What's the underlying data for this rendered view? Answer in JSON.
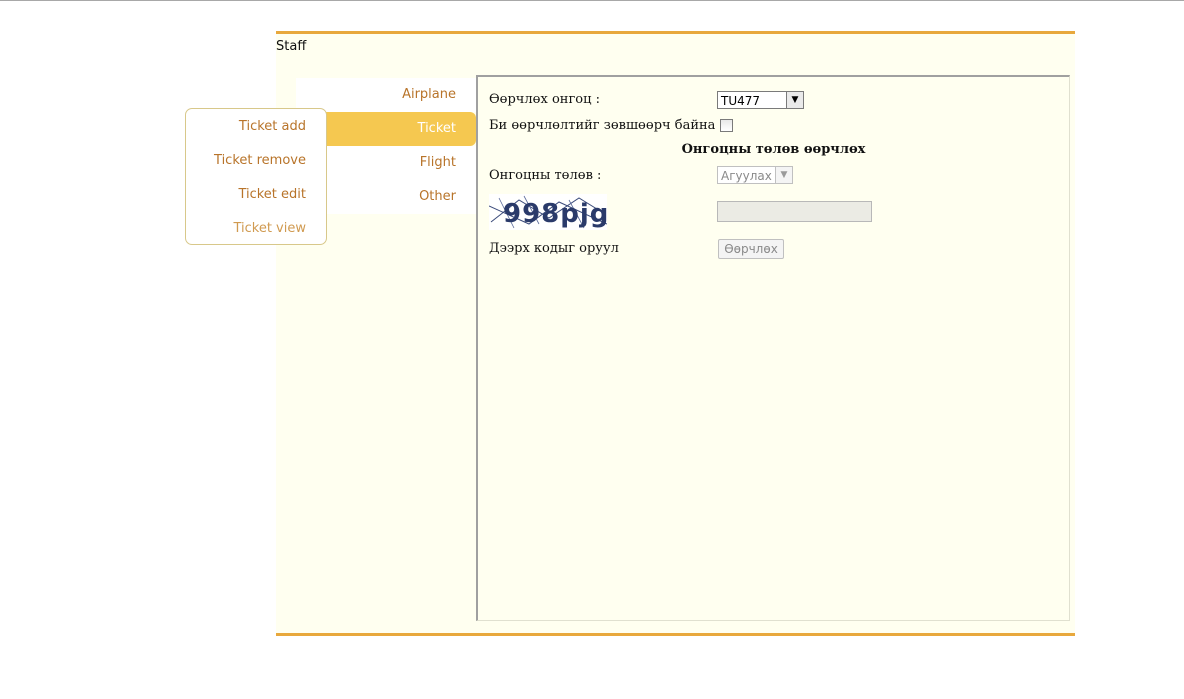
{
  "header": {
    "title": "Staff"
  },
  "menu": {
    "items": [
      {
        "label": "Airplane"
      },
      {
        "label": "Ticket"
      },
      {
        "label": "Flight"
      },
      {
        "label": "Other"
      }
    ]
  },
  "submenu": {
    "items": [
      {
        "label": "Ticket add"
      },
      {
        "label": "Ticket remove"
      },
      {
        "label": "Ticket edit"
      },
      {
        "label": "Ticket view"
      }
    ]
  },
  "form": {
    "plane_label": "Өөрчлөх онгоц :",
    "plane_value": "TU477",
    "consent_label": "Би өөрчлөлтийг зөвшөөрч байна",
    "consent_checked": false,
    "section_title": "Онгоцны төлөв өөрчлөх",
    "status_label": "Онгоцны төлөв :",
    "status_value": "Агуулах",
    "captcha_text": "998pjg",
    "captcha_hint": "Дээрх кодыг оруул",
    "captcha_input_value": "",
    "submit_label": "Өөрчлөх"
  },
  "colors": {
    "accent": "#e8a83c",
    "menu_active": "#f5c850",
    "menu_text": "#b8742a",
    "background": "#fffff0",
    "captcha_ink": "#2a3a6a"
  }
}
